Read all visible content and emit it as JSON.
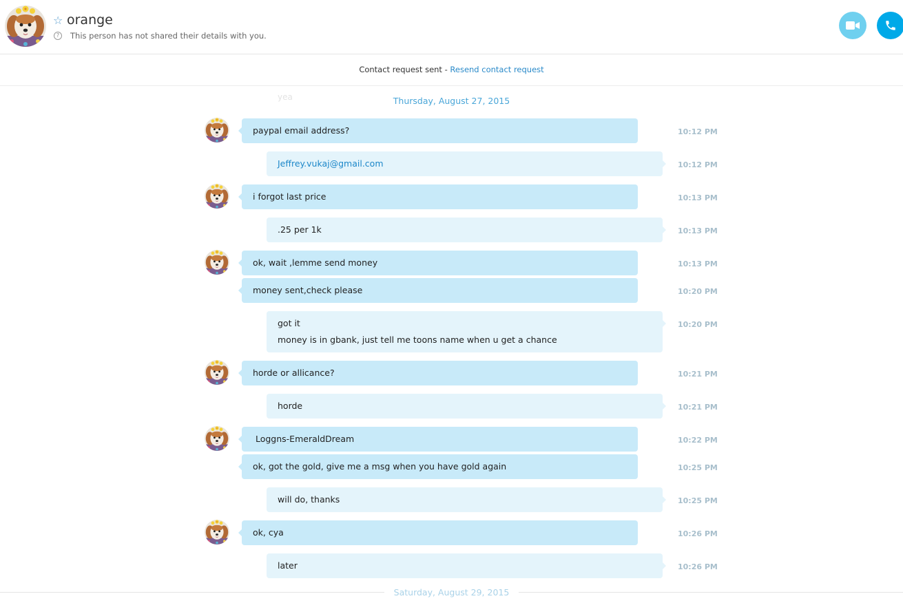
{
  "header": {
    "contact_name": "orange",
    "status_text": "This person has not shared their details with you."
  },
  "request_bar": {
    "text": "Contact request sent - ",
    "link": "Resend contact request"
  },
  "chat": {
    "ghost_text": "yea",
    "date_top": "Thursday, August 27, 2015",
    "date_bottom": "Saturday, August 29, 2015",
    "messages": [
      {
        "from": "contact",
        "lines": [
          "paypal email address?"
        ],
        "time": "10:12 PM"
      },
      {
        "from": "me",
        "lines": [
          "Jeffrey.vukaj@gmail.com"
        ],
        "time": "10:12 PM"
      },
      {
        "from": "contact",
        "lines": [
          "i forgot last price"
        ],
        "time": "10:13 PM"
      },
      {
        "from": "me",
        "lines": [
          ".25 per 1k"
        ],
        "time": "10:13 PM"
      },
      {
        "from": "contact",
        "lines": [
          "ok, wait ,lemme send money"
        ],
        "time": "10:13 PM"
      },
      {
        "from": "contact",
        "lines": [
          "money sent,check please"
        ],
        "time": "10:20 PM"
      },
      {
        "from": "me",
        "lines": [
          "got it",
          "money is in gbank, just tell me toons name when u get a chance"
        ],
        "time": "10:20 PM"
      },
      {
        "from": "contact",
        "lines": [
          "horde or allicance?"
        ],
        "time": "10:21 PM"
      },
      {
        "from": "me",
        "lines": [
          "horde"
        ],
        "time": "10:21 PM"
      },
      {
        "from": "contact",
        "lines": [
          " Loggns-EmeraldDream"
        ],
        "time": "10:22 PM"
      },
      {
        "from": "contact",
        "lines": [
          "ok, got the gold, give me a msg when you have gold again"
        ],
        "time": "10:25 PM"
      },
      {
        "from": "me",
        "lines": [
          "will do, thanks"
        ],
        "time": "10:25 PM"
      },
      {
        "from": "contact",
        "lines": [
          "ok, cya"
        ],
        "time": "10:26 PM"
      },
      {
        "from": "me",
        "lines": [
          "later"
        ],
        "time": "10:26 PM"
      }
    ]
  },
  "colors": {
    "incoming_bubble": "#c8eaf9",
    "outgoing_bubble": "#e4f4fb",
    "accent": "#00a9e8",
    "date_text": "#49a6d8"
  },
  "icons": {
    "favorite": "star-outline-icon",
    "info": "question-circle-icon",
    "video": "video-camera-icon",
    "call": "phone-icon"
  }
}
